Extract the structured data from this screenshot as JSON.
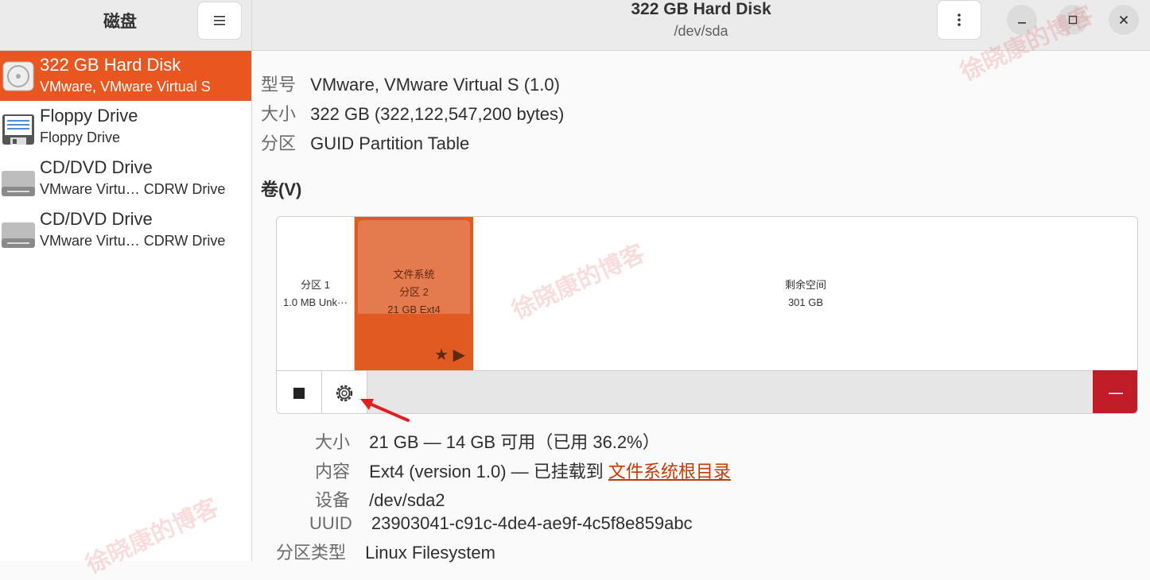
{
  "app": {
    "title": "磁盘"
  },
  "window": {
    "title": "322 GB Hard Disk",
    "subtitle": "/dev/sda"
  },
  "disks": [
    {
      "name": "322 GB Hard Disk",
      "detail": "VMware, VMware Virtual S",
      "icon": "hard-disk-icon",
      "selected": true
    },
    {
      "name": "Floppy Drive",
      "detail": "Floppy Drive",
      "icon": "floppy-icon",
      "selected": false
    },
    {
      "name": "CD/DVD Drive",
      "detail": "VMware Virtu… CDRW Drive",
      "icon": "optical-drive-icon",
      "selected": false
    },
    {
      "name": "CD/DVD Drive",
      "detail": "VMware Virtu… CDRW Drive",
      "icon": "optical-drive-icon",
      "selected": false
    }
  ],
  "disk_info": {
    "model_label": "型号",
    "model_value": "VMware, VMware Virtual S (1.0)",
    "size_label": "大小",
    "size_value": "322 GB (322,122,547,200 bytes)",
    "partitioning_label": "分区",
    "partitioning_value": "GUID Partition Table"
  },
  "volumes_title": "卷(V)",
  "volumes": [
    {
      "line1": "分区 1",
      "line2": "1.0 MB Unk···",
      "line3": ""
    },
    {
      "line1": "文件系统",
      "line2": "分区 2",
      "line3": "21 GB Ext4",
      "selected": true,
      "badges": "★ ▶"
    },
    {
      "line1": "剩余空间",
      "line2": "301 GB",
      "line3": ""
    }
  ],
  "volume_info": {
    "size_label": "大小",
    "size_value": "21 GB — 14 GB 可用（已用 36.2%）",
    "contents_label": "内容",
    "contents_value": "Ext4 (version 1.0) — 已挂载到 ",
    "contents_link": "文件系统根目录",
    "device_label": "设备",
    "device_value": "/dev/sda2",
    "uuid_label": "UUID",
    "uuid_value": "23903041-c91c-4de4-ae9f-4c5f8e859abc",
    "ptype_label": "分区类型",
    "ptype_value": "Linux Filesystem"
  },
  "toolbar": {
    "delete_label": "—"
  },
  "watermark": "徐晓康的博客",
  "colors": {
    "accent": "#e9561f",
    "danger": "#c01c28",
    "link": "#c23a0a"
  }
}
